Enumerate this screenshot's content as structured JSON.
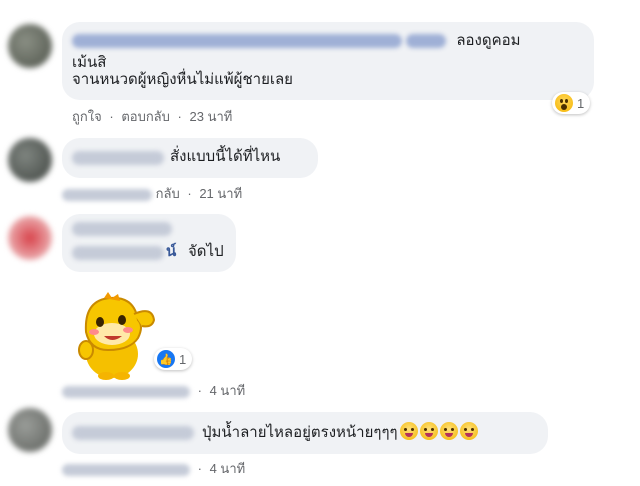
{
  "comments": [
    {
      "text_line1": "ลองดูคอมเม้นสิ",
      "text_line2": "จานหนวดผู้หญิงหื่นไม่แพ้ผู้ชายเลย",
      "actions": {
        "like": "ถูกใจ",
        "reply": "ตอบกลับ",
        "time": "23 นาที"
      },
      "reaction": {
        "icon": "wow-icon",
        "count": "1"
      }
    },
    {
      "text": "สั่งแบบนี้ได้ที่ไหน",
      "actions": {
        "reply": "กลับ",
        "time": "21 นาที"
      }
    },
    {
      "name_fragment": "น์",
      "text": "จัดไป"
    },
    {
      "sticker": "dinosaur-sticker",
      "reaction": {
        "icon": "like-icon",
        "count": "1"
      },
      "actions": {
        "time": "4 นาที"
      }
    },
    {
      "text": "ปุ่มน้ำลายไหลอยู่ตรงหน้ายๆๆๆ",
      "actions": {
        "time": "4 นาที"
      }
    }
  ],
  "separator": "·",
  "colors": {
    "bubble": "#f0f2f5",
    "link": "#65676b",
    "like_blue": "#1877f2"
  }
}
